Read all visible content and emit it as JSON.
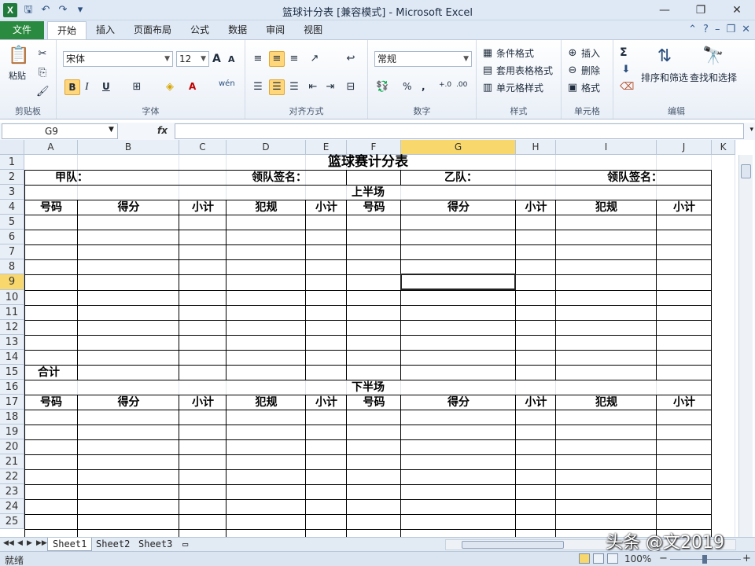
{
  "window": {
    "title": "篮球计分表  [兼容模式] - Microsoft Excel",
    "app_icon": "X",
    "minimize": "—",
    "restore": "❐",
    "close": "✕"
  },
  "tabs": {
    "file": "文件",
    "items": [
      "开始",
      "插入",
      "页面布局",
      "公式",
      "数据",
      "审阅",
      "视图"
    ],
    "active": "开始"
  },
  "ribbon": {
    "clipboard": {
      "label": "剪贴板",
      "paste": "粘贴"
    },
    "font": {
      "label": "字体",
      "name": "宋体",
      "size": "12",
      "bold": "B",
      "italic": "I",
      "underline": "U",
      "grow": "A",
      "shrink": "A",
      "wen": "wén"
    },
    "alignment": {
      "label": "对齐方式"
    },
    "number": {
      "label": "数字",
      "format": "常规",
      "percent": "%",
      "comma": ","
    },
    "styles": {
      "label": "样式",
      "conditional": "条件格式",
      "table": "套用表格格式",
      "cell_styles": "单元格样式"
    },
    "cells": {
      "label": "单元格",
      "insert": "插入",
      "delete": "删除",
      "format": "格式"
    },
    "editing": {
      "label": "编辑",
      "sort": "排序和筛选",
      "find": "查找和选择",
      "sum": "Σ"
    }
  },
  "formula_bar": {
    "name_box": "G9",
    "fx": "fx",
    "value": ""
  },
  "grid": {
    "columns": [
      "A",
      "B",
      "C",
      "D",
      "E",
      "F",
      "G",
      "H",
      "I",
      "J",
      "K"
    ],
    "rows": [
      "1",
      "2",
      "3",
      "4",
      "5",
      "6",
      "7",
      "8",
      "9",
      "10",
      "11",
      "12",
      "13",
      "14",
      "15",
      "16",
      "17",
      "18",
      "19",
      "20",
      "21",
      "22",
      "23",
      "24",
      "25"
    ],
    "selected_cell": "G9",
    "cells": {
      "title": "篮球赛计分表",
      "team_a": "甲队：",
      "captain_a": "领队签名：",
      "team_b": "乙队：",
      "captain_b": "领队签名：",
      "first_half": "上半场",
      "second_half": "下半场",
      "total": "合计",
      "h_number": "号码",
      "h_score": "得分",
      "h_subtotal": "小计",
      "h_foul": "犯规"
    }
  },
  "sheets": [
    "Sheet1",
    "Sheet2",
    "Sheet3"
  ],
  "active_sheet": "Sheet1",
  "status": {
    "text": "就绪",
    "zoom": "100%"
  },
  "watermark": "头条 @文2019",
  "colors": {
    "file_tab": "#2a8a3f",
    "selected_header": "#f8d86c",
    "ribbon_bg": "#dfe9f5"
  }
}
